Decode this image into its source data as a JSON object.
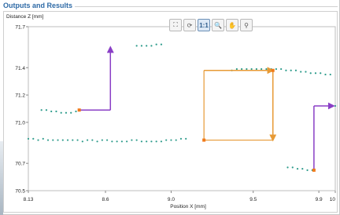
{
  "panel": {
    "title": "Outputs and Results"
  },
  "toolbar": [
    {
      "name": "fit-icon",
      "glyph": "⛶"
    },
    {
      "name": "rotate-icon",
      "glyph": "⟳"
    },
    {
      "name": "one-to-one-icon",
      "glyph": "1:1"
    },
    {
      "name": "zoom-icon",
      "glyph": "🔍"
    },
    {
      "name": "pan-icon",
      "glyph": "✋"
    },
    {
      "name": "pick-icon",
      "glyph": "⚲"
    }
  ],
  "chart_data": {
    "type": "scatter",
    "ylabel": "Distance Z [mm]",
    "xlabel": "Position X [mm]",
    "xlim": [
      8.13,
      10.0
    ],
    "ylim": [
      70.5,
      71.7
    ],
    "x_ticks": [
      {
        "value": 8.13,
        "label": "8.13"
      },
      {
        "value": 8.6,
        "label": "8.6"
      },
      {
        "value": 9.0,
        "label": "9.0"
      },
      {
        "value": 9.5,
        "label": "9.5"
      },
      {
        "value": 9.9,
        "label": "9.9"
      },
      {
        "value": 10.0,
        "label": "10"
      }
    ],
    "y_ticks": [
      {
        "value": 71.7,
        "label": "71.7"
      },
      {
        "value": 71.4,
        "label": "71.4"
      },
      {
        "value": 71.2,
        "label": "71.2"
      },
      {
        "value": 71.0,
        "label": "71.0"
      },
      {
        "value": 70.7,
        "label": "70.7"
      },
      {
        "value": 70.5,
        "label": "70.5"
      }
    ],
    "point_color": "#2e9c8c",
    "marker_color": "#f07a1a",
    "series": [
      {
        "values": [
          [
            8.21,
            71.09
          ],
          [
            8.24,
            71.09
          ],
          [
            8.27,
            71.08
          ],
          [
            8.3,
            71.08
          ],
          [
            8.33,
            71.07
          ],
          [
            8.36,
            71.07
          ],
          [
            8.39,
            71.07
          ],
          [
            8.42,
            71.08
          ]
        ]
      },
      {
        "values": [
          [
            8.79,
            71.56
          ],
          [
            8.82,
            71.56
          ],
          [
            8.85,
            71.56
          ],
          [
            8.88,
            71.56
          ],
          [
            8.91,
            71.57
          ],
          [
            8.94,
            71.57
          ]
        ]
      },
      {
        "values": [
          [
            8.13,
            70.88
          ],
          [
            8.16,
            70.88
          ],
          [
            8.19,
            70.87
          ],
          [
            8.22,
            70.88
          ],
          [
            8.25,
            70.87
          ],
          [
            8.28,
            70.87
          ],
          [
            8.31,
            70.87
          ],
          [
            8.34,
            70.87
          ],
          [
            8.37,
            70.87
          ],
          [
            8.4,
            70.87
          ],
          [
            8.43,
            70.87
          ],
          [
            8.46,
            70.86
          ],
          [
            8.49,
            70.87
          ],
          [
            8.52,
            70.87
          ],
          [
            8.55,
            70.86
          ],
          [
            8.58,
            70.87
          ],
          [
            8.61,
            70.87
          ],
          [
            8.64,
            70.86
          ],
          [
            8.67,
            70.86
          ],
          [
            8.7,
            70.86
          ],
          [
            8.73,
            70.86
          ],
          [
            8.76,
            70.87
          ],
          [
            8.79,
            70.87
          ],
          [
            8.82,
            70.86
          ],
          [
            8.85,
            70.86
          ],
          [
            8.88,
            70.86
          ],
          [
            8.91,
            70.86
          ],
          [
            8.94,
            70.86
          ],
          [
            8.97,
            70.87
          ],
          [
            9.0,
            70.87
          ],
          [
            9.03,
            70.87
          ],
          [
            9.06,
            70.88
          ],
          [
            9.09,
            70.88
          ]
        ]
      },
      {
        "values": [
          [
            9.37,
            71.38
          ],
          [
            9.4,
            71.39
          ],
          [
            9.43,
            71.39
          ],
          [
            9.46,
            71.39
          ],
          [
            9.49,
            71.39
          ],
          [
            9.52,
            71.39
          ],
          [
            9.55,
            71.39
          ],
          [
            9.58,
            71.39
          ],
          [
            9.61,
            71.39
          ],
          [
            9.64,
            71.39
          ],
          [
            9.67,
            71.39
          ],
          [
            9.7,
            71.38
          ],
          [
            9.73,
            71.38
          ],
          [
            9.76,
            71.38
          ],
          [
            9.79,
            71.37
          ],
          [
            9.82,
            71.37
          ],
          [
            9.85,
            71.36
          ],
          [
            9.88,
            71.36
          ],
          [
            9.91,
            71.36
          ],
          [
            9.94,
            71.35
          ],
          [
            9.97,
            71.35
          ]
        ]
      },
      {
        "values": [
          [
            9.71,
            70.67
          ],
          [
            9.74,
            70.67
          ],
          [
            9.77,
            70.66
          ],
          [
            9.8,
            70.66
          ],
          [
            9.83,
            70.65
          ],
          [
            9.86,
            70.65
          ]
        ]
      },
      {
        "values": [
          [
            9.97,
            71.12
          ],
          [
            10.0,
            71.12
          ],
          [
            10.03,
            71.13
          ],
          [
            10.06,
            71.13
          ]
        ]
      }
    ],
    "markers": [
      {
        "x": 8.44,
        "y": 71.09
      },
      {
        "x": 9.2,
        "y": 70.87
      },
      {
        "x": 9.62,
        "y": 71.38
      },
      {
        "x": 9.87,
        "y": 70.65
      }
    ],
    "annotations": [
      {
        "type": "step",
        "color": "#8a3fc6",
        "x1": 8.44,
        "y1": 71.09,
        "xc": 8.86,
        "yc": 71.55
      },
      {
        "type": "step",
        "color": "#8a3fc6",
        "x1": 9.87,
        "y1": 70.65,
        "xc": 10.06,
        "yc": 71.12
      },
      {
        "type": "box",
        "color": "#e79a35",
        "x1": 9.2,
        "y1": 71.38,
        "x2": 9.62,
        "y2": 70.87
      }
    ]
  }
}
